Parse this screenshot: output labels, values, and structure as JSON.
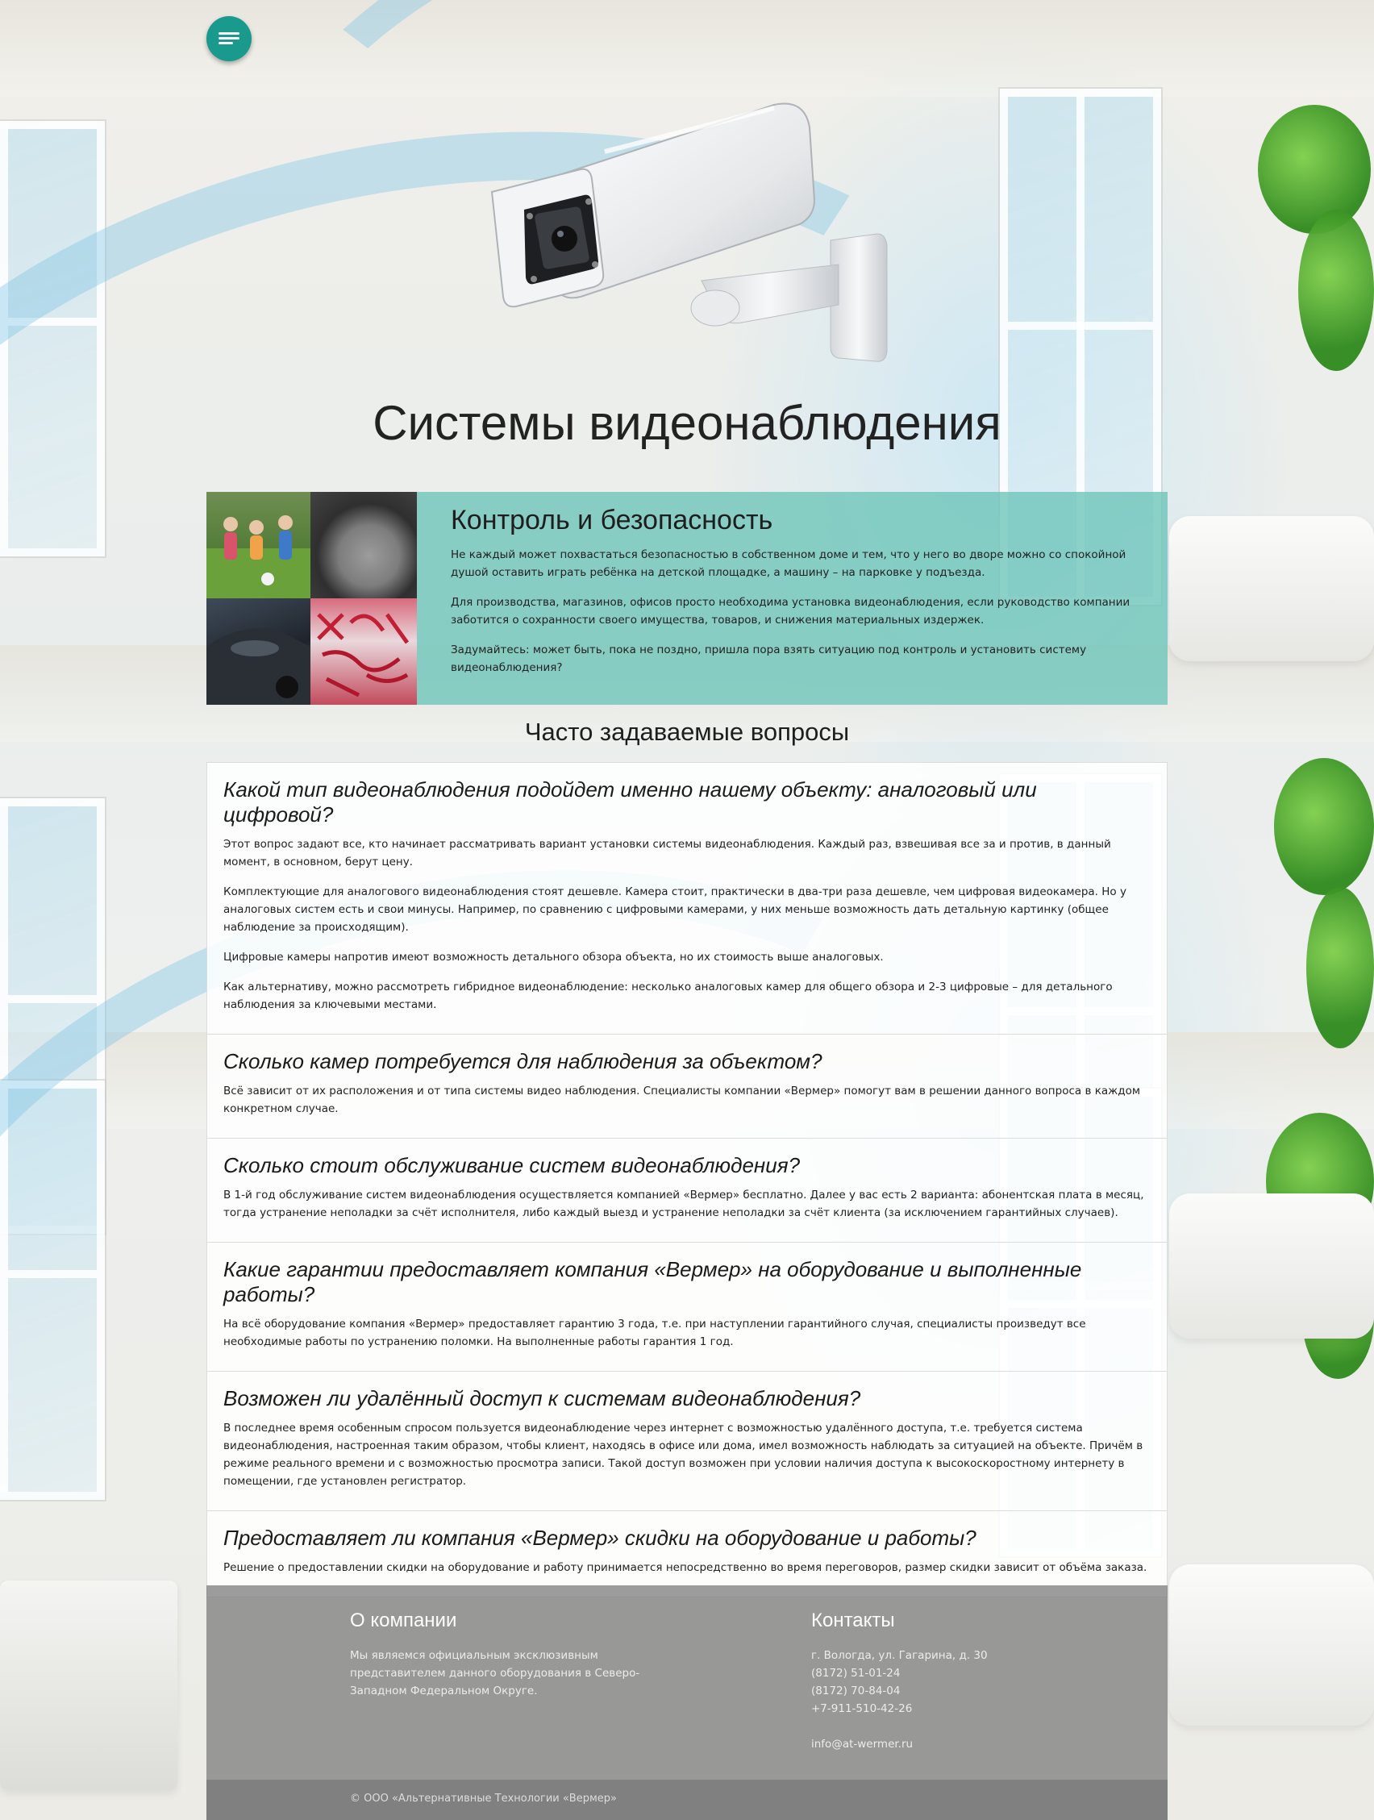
{
  "hero": {
    "title": "Системы видеонаблюдения"
  },
  "security": {
    "title": "Контроль и безопасность",
    "paragraphs": [
      "Не каждый может похвастаться безопасностью в собственном доме и тем, что у него во дворе можно со спокойной душой оставить играть ребёнка на детской площадке, а машину – на парковке у подъезда.",
      "Для производства, магазинов, офисов просто необходима установка видеонаблюдения, если руководство компании заботится о сохранности своего имущества, товаров, и снижения материальных издержек.",
      "Задумайтесь: может быть, пока не поздно, пришла пора взять ситуацию под контроль и установить систему видеонаблюдения?"
    ]
  },
  "faq": {
    "title": "Часто задаваемые вопросы",
    "items": [
      {
        "question": "Какой тип видеонаблюдения подойдет именно нашему объекту: аналоговый или цифровой?",
        "answers": [
          "Этот вопрос задают все, кто начинает рассматривать вариант установки системы видеонаблюдения. Каждый раз, взвешивая все за и против, в данный момент, в основном, берут цену.",
          "Комплектующие для аналогового видеонаблюдения стоят дешевле. Камера стоит, практически в два-три раза дешевле, чем цифровая видеокамера. Но у аналоговых систем есть и свои минусы. Например, по сравнению с цифровыми камерами, у них меньше возможность дать детальную картинку (общее наблюдение за происходящим).",
          "Цифровые камеры напротив имеют возможность детального обзора объекта, но их стоимость выше аналоговых.",
          "Как альтернативу, можно рассмотреть гибридное видеонаблюдение: несколько аналоговых камер для общего обзора и 2-3 цифровые – для детального наблюдения за ключевыми местами."
        ]
      },
      {
        "question": "Сколько камер потребуется для наблюдения за объектом?",
        "answers": [
          "Всё зависит от их расположения и от типа системы видео наблюдения. Специалисты компании «Вермер» помогут вам в решении данного вопроса в каждом конкретном случае."
        ]
      },
      {
        "question": "Сколько стоит обслуживание систем видеонаблюдения?",
        "answers": [
          "В 1-й год обслуживание систем видеонаблюдения осуществляется компанией «Вермер» бесплатно. Далее у вас есть 2 варианта: абонентская плата в месяц, тогда устранение неполадки за счёт исполнителя, либо каждый выезд и устранение неполадки за счёт клиента (за исключением гарантийных случаев)."
        ]
      },
      {
        "question": "Какие гарантии предоставляет компания «Вермер» на оборудование и выполненные работы?",
        "answers": [
          "На всё оборудование компания «Вермер» предоставляет гарантию 3 года, т.е. при наступлении гарантийного случая, специалисты произведут все необходимые работы по устранению поломки. На выполненные работы гарантия 1 год."
        ]
      },
      {
        "question": "Возможен ли удалённый доступ к системам видеонаблюдения?",
        "answers": [
          "В последнее время особенным спросом пользуется видеонаблюдение через интернет с возможностью удалённого доступа, т.е. требуется система видеонаблюдения, настроенная таким образом, чтобы клиент, находясь в офисе или дома, имел возможность наблюдать за ситуацией на объекте. Причём в режиме реального времени и с возможностью просмотра записи. Такой доступ возможен при условии наличия доступа к высокоскоростному интернету в помещении, где установлен регистратор."
        ]
      },
      {
        "question": "Предоставляет ли компания «Вермер» скидки на оборудование и работы?",
        "answers": [
          "Решение о предоставлении скидки на оборудование и работу принимается непосредственно во время переговоров, размер скидки зависит от объёма заказа."
        ]
      }
    ]
  },
  "footer": {
    "about_title": "О компании",
    "about_text": "Мы являемся официальным эксклюзивным представителем данного оборудования в Северо-Западном Федеральном Округе.",
    "contacts_title": "Контакты",
    "address": "г. Вологда, ул. Гагарина, д. 30",
    "phone1": "(8172) 51-01-24",
    "phone2": "(8172) 70-84-04",
    "phone3": "+7-911-510-42-26",
    "email": "info@at-wermer.ru",
    "copyright": "© ООО «Альтернативные Технологии «Вермер»"
  },
  "icons": {
    "menu": "menu-icon",
    "camera": "cctv-camera-illustration"
  },
  "colors": {
    "accent": "#1a9a8c",
    "security_block": "#6cc4b8",
    "footer": "#808080"
  }
}
